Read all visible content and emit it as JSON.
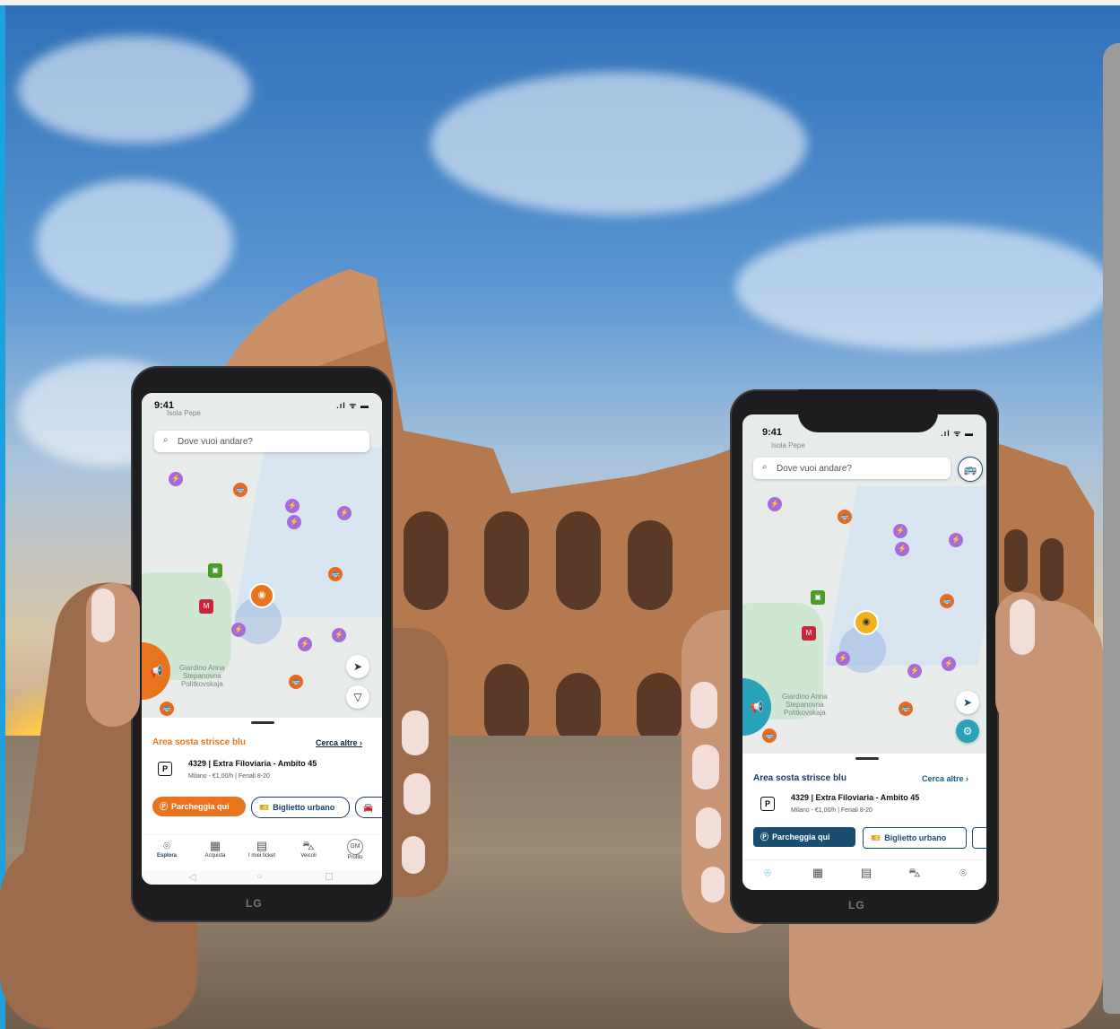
{
  "phone_left": {
    "status_time": "9:41",
    "status_icons": ".ıl ᯤ ▬",
    "map_top_label": "Isola Pepe",
    "search_placeholder": "Dove vuoi andare?",
    "map_label_garden": "Giardino Anna\nStepanovna\nPolitkovskaja",
    "area_title": "Area sosta strisce blu",
    "more_link": "Cerca altre ›",
    "parking_code": "4329 | Extra Filoviaria - Ambito 45",
    "parking_sub": "Milano - €1,00/h | Feriali 8-20",
    "btn_park": "Parcheggia qui",
    "btn_ticket": "Biglietto urbano",
    "tabs": [
      {
        "label": "Esplora",
        "icon": "pin-icon"
      },
      {
        "label": "Acquista",
        "icon": "store-icon"
      },
      {
        "label": "I miei ticket",
        "icon": "ticket-icon"
      },
      {
        "label": "Veicoli",
        "icon": "car-icon"
      },
      {
        "label": "Profilo",
        "icon": "avatar-icon",
        "initials": "GM"
      }
    ],
    "brand": "LG"
  },
  "phone_right": {
    "status_time": "9:41",
    "status_icons": ".ıl ᯤ ▬",
    "map_top_label": "Isola Pepe",
    "search_placeholder": "Dove vuoi andare?",
    "map_label_garden": "Giardino Anna\nStepanovna\nPolitkovskaja",
    "area_title": "Area sosta strisce blu",
    "more_link": "Cerca altre ›",
    "parking_code": "4329 | Extra Filoviaria - Ambito 45",
    "parking_sub": "Milano - €1,00/h | Feriali 8-20",
    "btn_park": "Parcheggia qui",
    "btn_ticket": "Biglietto urbano",
    "brand": "LG"
  },
  "colors": {
    "accent_orange": "#e8741d",
    "accent_navy": "#1a3c66",
    "accent_teal": "#1a4d6e"
  }
}
